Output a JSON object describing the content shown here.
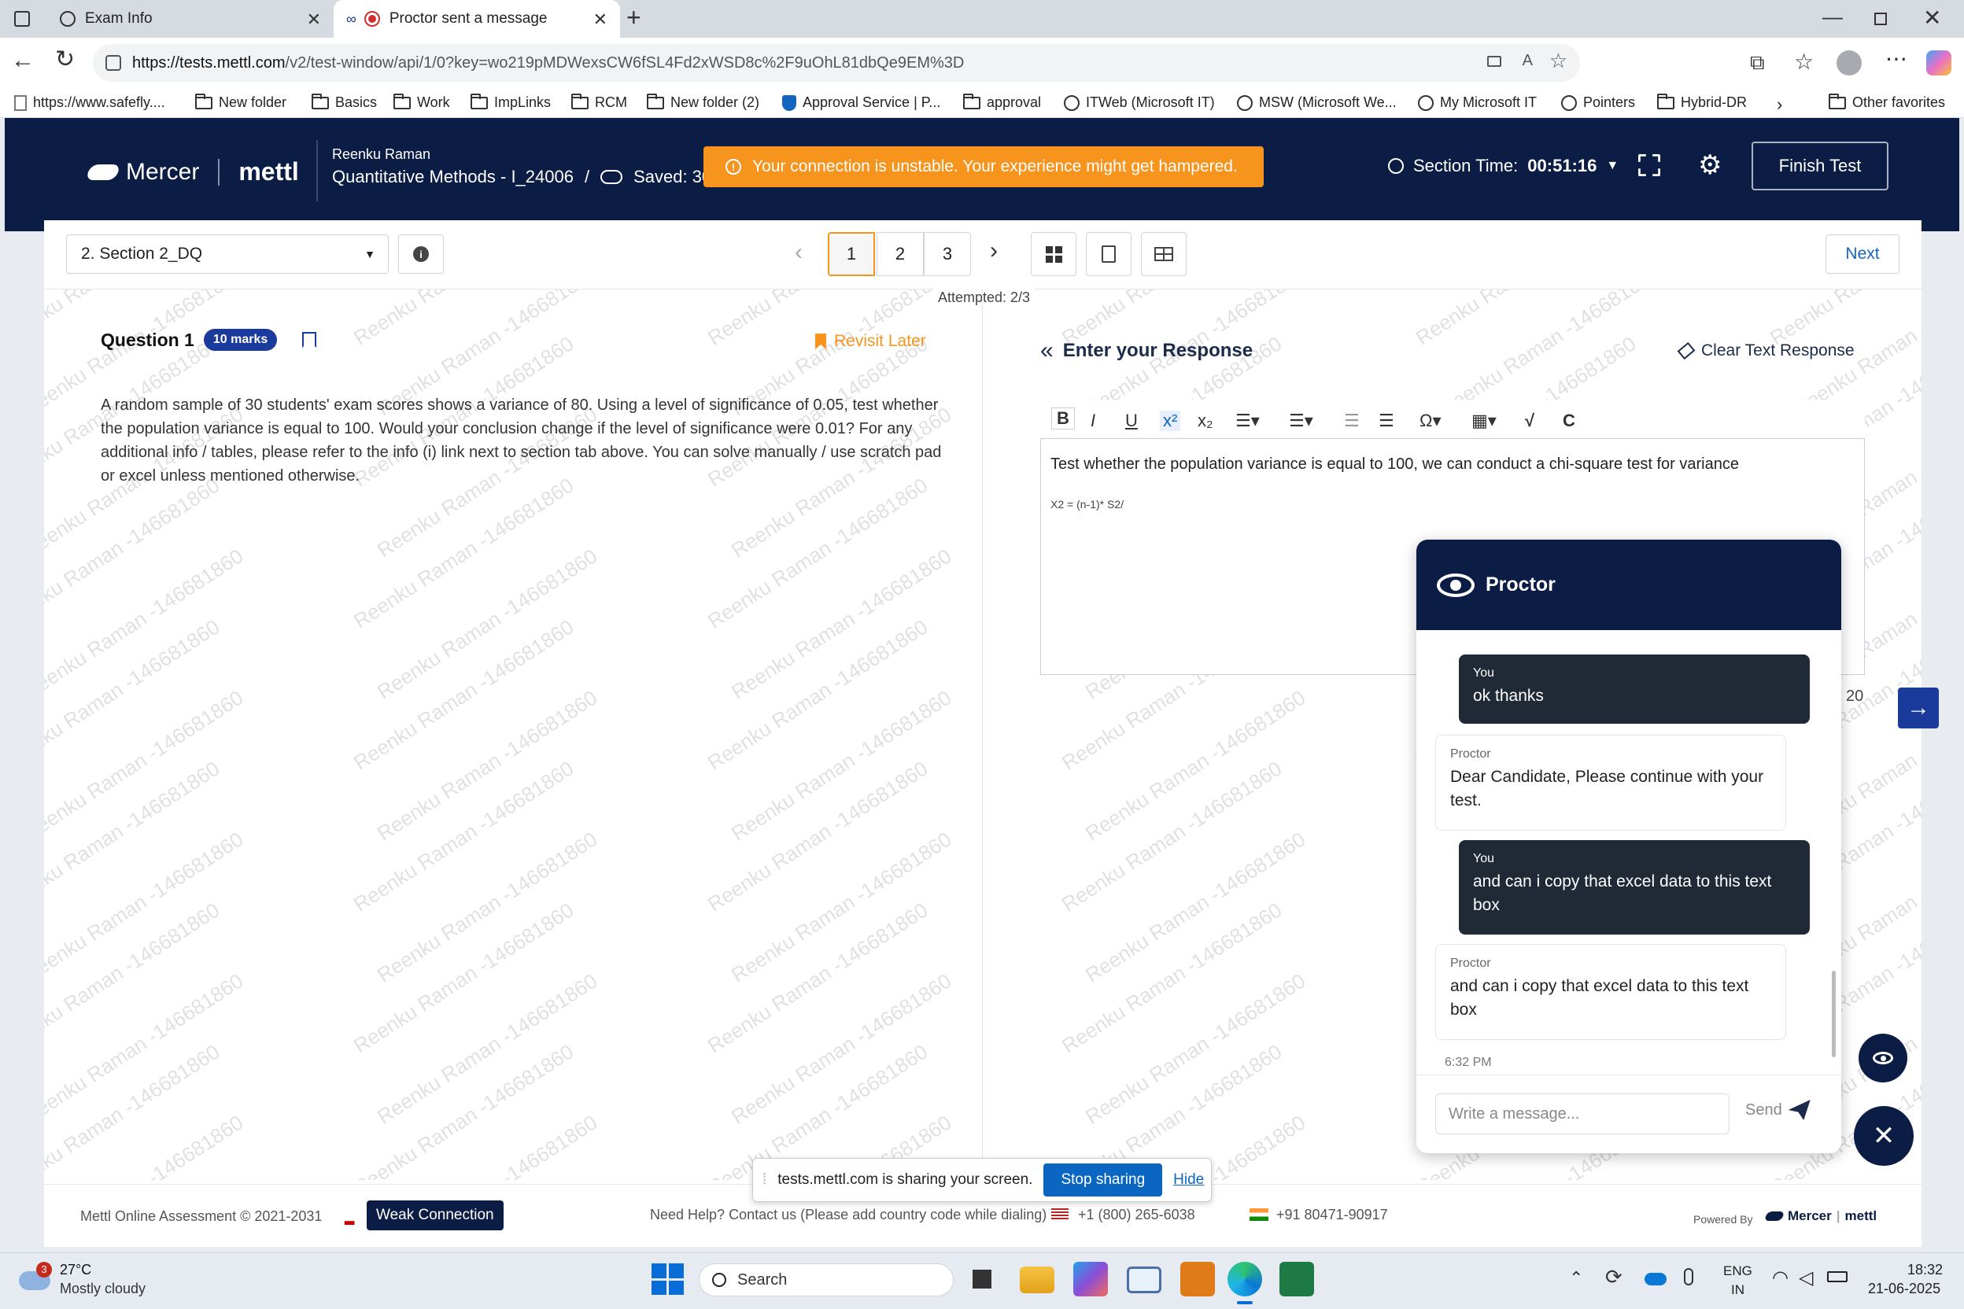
{
  "browser": {
    "tabs": [
      {
        "title": "Exam Info",
        "active": false
      },
      {
        "title": "Proctor sent a message",
        "active": true
      }
    ],
    "url_host": "https://tests.mettl.com",
    "url_path": "/v2/test-window/api/1/0?key=wo219pMDWexsCW6fSL4Fd2xWSD8c%2F9uOhL81dbQe9EM%3D",
    "bookmarks": [
      "https://www.safefly....",
      "New folder",
      "Basics",
      "Work",
      "ImpLinks",
      "RCM",
      "New folder (2)",
      "Approval Service | P...",
      "approval",
      "ITWeb (Microsoft IT)",
      "MSW (Microsoft We...",
      "My Microsoft IT",
      "Pointers",
      "Hybrid-DR"
    ],
    "other_favorites": "Other favorites"
  },
  "header": {
    "brand": "Mercer",
    "brand2": "mettl",
    "candidate": "Reenku Raman",
    "test_name": "Quantitative Methods - I_24006",
    "separator": "/",
    "saved": "Saved: 30 s",
    "alert": "Your connection is unstable. Your experience might get hampered.",
    "section_time_label": "Section Time:",
    "section_time": "00:51:16",
    "finish_label": "Finish Test"
  },
  "controls": {
    "section_select": "2. Section 2_DQ",
    "pages": [
      "1",
      "2",
      "3"
    ],
    "attempted": "Attempted: 2/3",
    "next_label": "Next"
  },
  "question": {
    "title": "Question 1",
    "marks": "10 marks",
    "revisit": "Revisit Later",
    "text": "A random sample of 30 students' exam scores shows a variance of 80. Using a level of significance of 0.05, test whether the population variance is equal to 100. Would your conclusion change if the level of significance were 0.01? For any additional info / tables, please refer to the info (i) link next to section tab above. You can solve manually / use scratch pad or excel unless mentioned otherwise."
  },
  "response": {
    "title": "Enter your Response",
    "clear_label": "Clear Text Response",
    "line1": "Test whether the population variance is equal to 100, we can conduct a chi-square test for variance",
    "line2": "X2 = (n-1)* S2/",
    "counter_fragment": "20"
  },
  "watermark": "Reenku Raman -146681860",
  "proctor": {
    "title": "Proctor",
    "messages": [
      {
        "from": "You",
        "text": "ok thanks"
      },
      {
        "from": "Proctor",
        "text": "Dear Candidate, Please continue with your test."
      },
      {
        "from": "You",
        "text": "and can i copy that excel data to this text box"
      },
      {
        "from": "Proctor",
        "text": "and can i copy that excel data to this text box"
      }
    ],
    "time": "6:32 PM",
    "input_placeholder": "Write a message...",
    "send_label": "Send"
  },
  "footer": {
    "copyright": "Mettl Online Assessment © 2021-2031",
    "weak": "Weak Connection",
    "help": "Need Help? Contact us (Please add country code while dialing)",
    "phone_us": "+1 (800) 265-6038",
    "phone_in": "+91 80471-90917",
    "powered": "Powered By"
  },
  "share_bar": {
    "text": "tests.mettl.com is sharing your screen.",
    "stop": "Stop sharing",
    "hide": "Hide"
  },
  "taskbar": {
    "notif_count": "3",
    "temp": "27°C",
    "weather": "Mostly cloudy",
    "search": "Search",
    "lang1": "ENG",
    "lang2": "IN",
    "time": "18:32",
    "date": "21-06-2025"
  },
  "colors": {
    "navy": "#0b1d45",
    "alert": "#f7941d",
    "accent": "#1565c0"
  }
}
